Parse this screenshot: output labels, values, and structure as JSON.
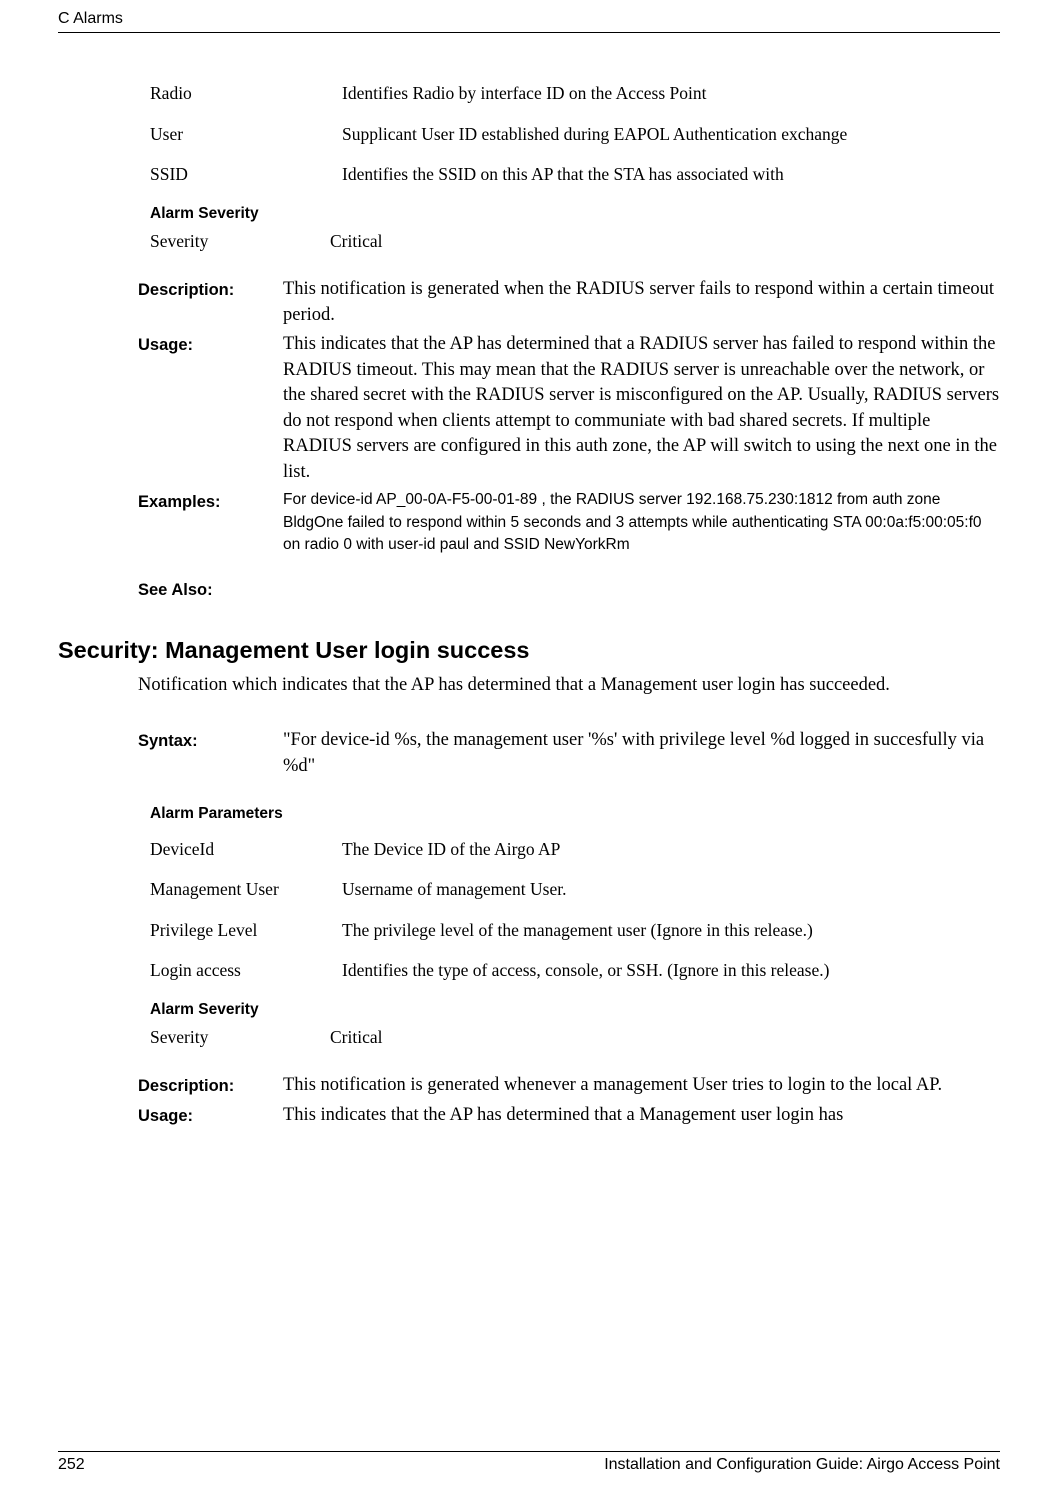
{
  "header": {
    "left": "C  Alarms",
    "right": ""
  },
  "top_params": [
    {
      "k": "Radio",
      "v": "Identifies Radio by interface ID on the Access Point"
    },
    {
      "k": "User",
      "v": "Supplicant User ID established during EAPOL Authentication  exchange"
    },
    {
      "k": "SSID",
      "v": "Identifies the SSID on this AP that the STA has associated with"
    }
  ],
  "severity_heading": "Alarm Severity",
  "severity_row": {
    "k": "Severity",
    "v": "Critical"
  },
  "defs1": [
    {
      "k": "Description:",
      "v": "This notification is generated when the RADIUS server fails to respond within a certain timeout period."
    },
    {
      "k": "Usage:",
      "v": "This indicates that the AP has determined that a RADIUS server has failed to respond within the RADIUS timeout. This may mean that the RADIUS server is unreachable over the network, or the shared secret with the RADIUS server is misconfigured on the AP. Usually, RADIUS servers do not respond when clients attempt to communiate with bad shared secrets. If multiple RADIUS servers are configured in this auth zone, the AP will switch to using the next one in the list."
    },
    {
      "k": "Examples:",
      "v": "For device-id AP_00-0A-F5-00-01-89 , the RADIUS server 192.168.75.230:1812 from auth zone BldgOne failed to respond within 5 seconds and 3 attempts while authenticating STA 00:0a:f5:00:05:f0 on radio 0 with user-id paul and SSID NewYorkRm",
      "sans": true
    }
  ],
  "see_also": "See Also:",
  "section2": {
    "title": "Security: Management User login success",
    "intro": "Notification which indicates that the AP has determined that a Management user login has succeeded.",
    "syntax_k": "Syntax:",
    "syntax_v": "\"For device-id %s, the management user '%s' with privilege level %d logged in succesfully via %d\"",
    "param_heading": "Alarm Parameters",
    "params": [
      {
        "k": "DeviceId",
        "v": "The Device ID of the Airgo AP"
      },
      {
        "k": "Management User",
        "v": "Username of management User."
      },
      {
        "k": "Privilege Level",
        "v": "The privilege level  of the management user (Ignore in this release.)"
      },
      {
        "k": "Login access",
        "v": "Identifies the type of access, console, or SSH. (Ignore in this release.)"
      }
    ],
    "severity_heading": "Alarm Severity",
    "severity_row": {
      "k": "Severity",
      "v": "Critical"
    },
    "defs": [
      {
        "k": "Description:",
        "v": "This notification is generated whenever a management User tries to login to the local AP."
      },
      {
        "k": "Usage:",
        "v": "This indicates that the AP has determined that a Management user login has"
      }
    ]
  },
  "footer": {
    "page": "252",
    "title": "Installation and Configuration Guide: Airgo Access Point"
  }
}
